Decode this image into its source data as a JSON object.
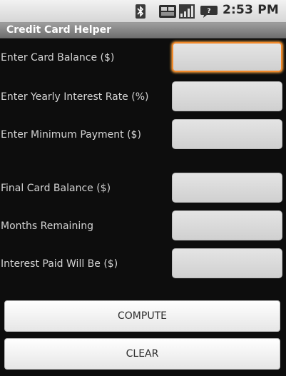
{
  "status_bar": {
    "time": "2:53 PM",
    "icons": [
      "bluetooth-icon",
      "notification-icon",
      "signal-icon",
      "chat-icon"
    ]
  },
  "app": {
    "title": "Credit Card Helper"
  },
  "form": {
    "card_balance": {
      "label": "Enter Card Balance ($)",
      "value": ""
    },
    "interest_rate": {
      "label": "Enter Yearly Interest Rate (%)",
      "value": ""
    },
    "minimum_payment": {
      "label": "Enter Minimum Payment ($)",
      "value": ""
    },
    "final_balance": {
      "label": "Final Card Balance ($)",
      "value": ""
    },
    "months_remaining": {
      "label": "Months Remaining",
      "value": ""
    },
    "interest_paid": {
      "label": "Interest Paid Will Be ($)",
      "value": ""
    }
  },
  "buttons": {
    "compute": "COMPUTE",
    "clear": "CLEAR"
  },
  "colors": {
    "focus_accent": "#f0882a",
    "background": "#0d0d0d",
    "label_text": "#d4d4d4"
  }
}
